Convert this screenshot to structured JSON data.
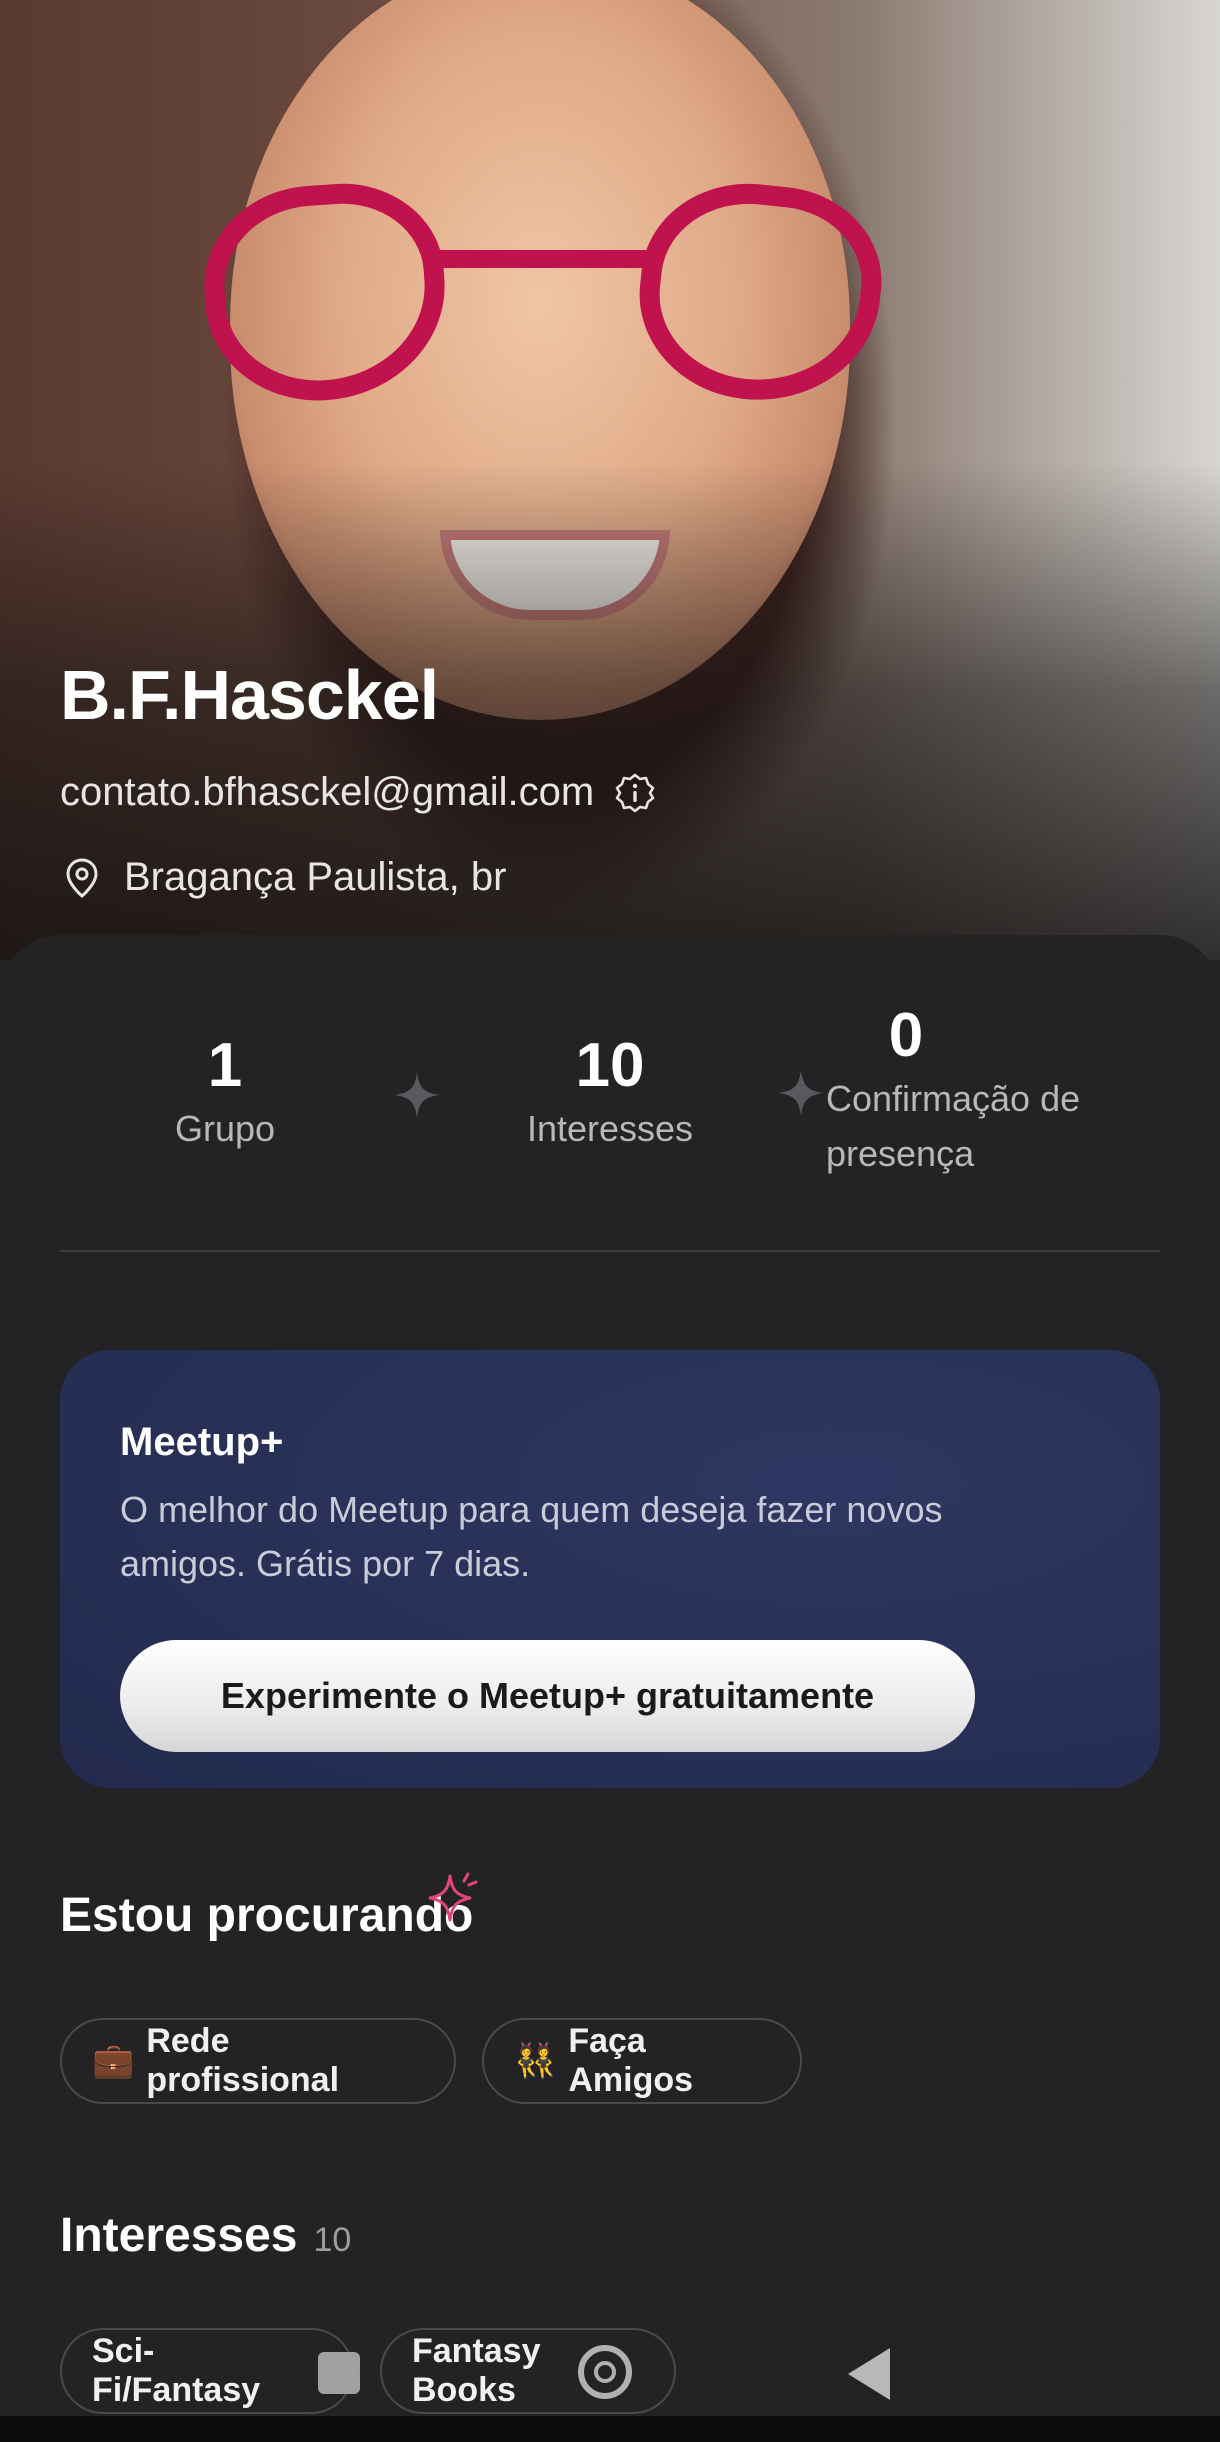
{
  "profile": {
    "name": "B.F.Hasckel",
    "email": "contato.bfhasckel@gmail.com",
    "location": "Bragança Paulista, br"
  },
  "stats": [
    {
      "value": "1",
      "label": "Grupo"
    },
    {
      "value": "10",
      "label": "Interesses"
    },
    {
      "value": "0",
      "label": "Confirmação de presença"
    }
  ],
  "promo": {
    "title": "Meetup+",
    "text": "O melhor do Meetup para quem deseja fazer novos amigos. Grátis por 7 dias.",
    "button_label": "Experimente o Meetup+ gratuitamente"
  },
  "looking_for": {
    "title": "Estou procurando",
    "chips": [
      {
        "emoji": "💼",
        "label": "Rede profissional"
      },
      {
        "emoji": "👯",
        "label": "Faça Amigos"
      }
    ]
  },
  "interests": {
    "title": "Interesses",
    "count": "10",
    "chips": [
      "Sci-Fi/Fantasy",
      "Fantasy Books"
    ]
  },
  "colors": {
    "background": "#232325",
    "promo_card": "#283056",
    "accent_star": "#e0457b"
  },
  "icons": [
    "info-icon",
    "location-pin-icon",
    "sparkle-icon",
    "star-decoration-icon"
  ]
}
